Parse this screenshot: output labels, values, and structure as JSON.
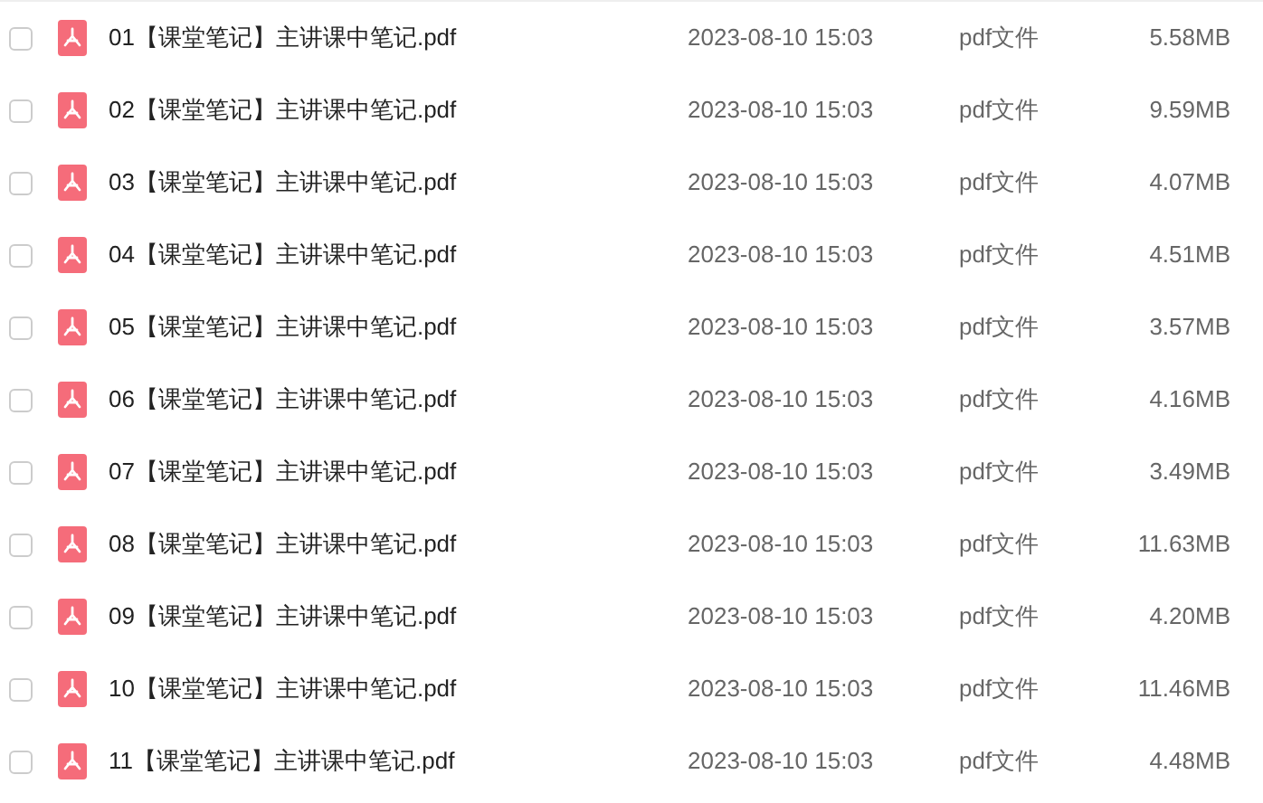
{
  "files": [
    {
      "name": "01【课堂笔记】主讲课中笔记.pdf",
      "modified": "2023-08-10 15:03",
      "type": "pdf文件",
      "size": "5.58MB",
      "checked": false
    },
    {
      "name": "02【课堂笔记】主讲课中笔记.pdf",
      "modified": "2023-08-10 15:03",
      "type": "pdf文件",
      "size": "9.59MB",
      "checked": false
    },
    {
      "name": "03【课堂笔记】主讲课中笔记.pdf",
      "modified": "2023-08-10 15:03",
      "type": "pdf文件",
      "size": "4.07MB",
      "checked": false
    },
    {
      "name": "04【课堂笔记】主讲课中笔记.pdf",
      "modified": "2023-08-10 15:03",
      "type": "pdf文件",
      "size": "4.51MB",
      "checked": false
    },
    {
      "name": "05【课堂笔记】主讲课中笔记.pdf",
      "modified": "2023-08-10 15:03",
      "type": "pdf文件",
      "size": "3.57MB",
      "checked": false
    },
    {
      "name": "06【课堂笔记】主讲课中笔记.pdf",
      "modified": "2023-08-10 15:03",
      "type": "pdf文件",
      "size": "4.16MB",
      "checked": false
    },
    {
      "name": "07【课堂笔记】主讲课中笔记.pdf",
      "modified": "2023-08-10 15:03",
      "type": "pdf文件",
      "size": "3.49MB",
      "checked": false
    },
    {
      "name": "08【课堂笔记】主讲课中笔记.pdf",
      "modified": "2023-08-10 15:03",
      "type": "pdf文件",
      "size": "11.63MB",
      "checked": false
    },
    {
      "name": "09【课堂笔记】主讲课中笔记.pdf",
      "modified": "2023-08-10 15:03",
      "type": "pdf文件",
      "size": "4.20MB",
      "checked": false
    },
    {
      "name": "10【课堂笔记】主讲课中笔记.pdf",
      "modified": "2023-08-10 15:03",
      "type": "pdf文件",
      "size": "11.46MB",
      "checked": false
    },
    {
      "name": "11【课堂笔记】主讲课中笔记.pdf",
      "modified": "2023-08-10 15:03",
      "type": "pdf文件",
      "size": "4.48MB",
      "checked": false
    }
  ]
}
